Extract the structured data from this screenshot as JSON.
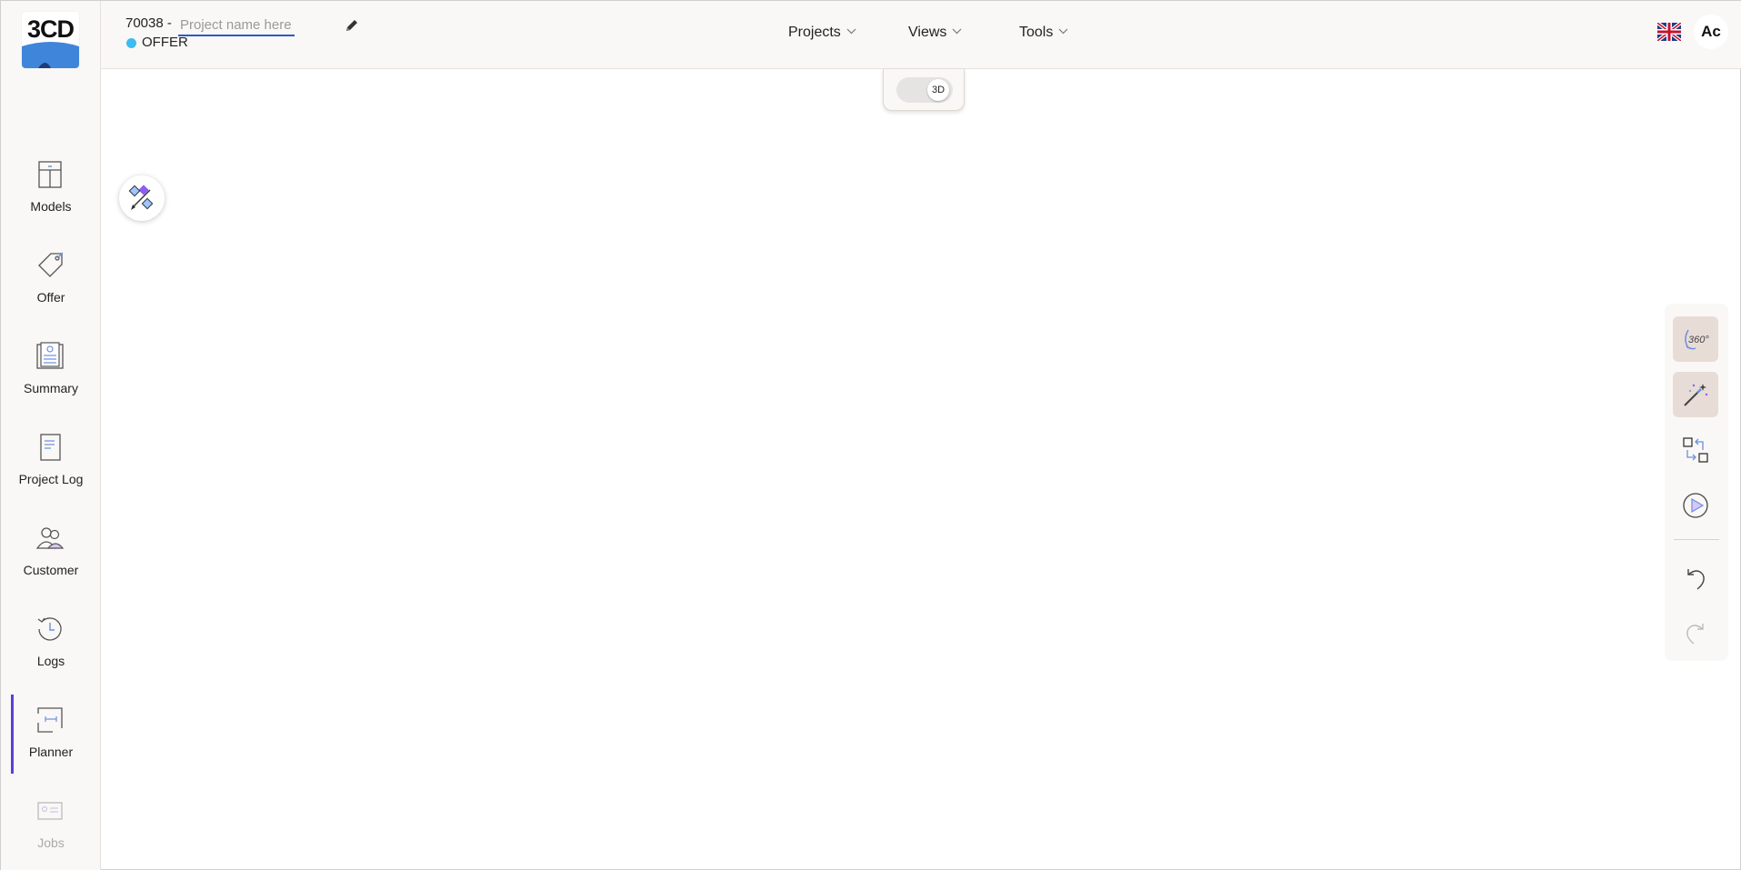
{
  "app": {
    "logo_text": "3CD",
    "accent_color": "#5b3fd6",
    "status_color": "#3cbcf0"
  },
  "sidebar": {
    "items": [
      {
        "label": "Models",
        "icon": "models-icon"
      },
      {
        "label": "Offer",
        "icon": "tag-icon"
      },
      {
        "label": "Summary",
        "icon": "summary-icon"
      },
      {
        "label": "Project Log",
        "icon": "document-icon"
      },
      {
        "label": "Customer",
        "icon": "customer-icon"
      },
      {
        "label": "Logs",
        "icon": "history-icon"
      },
      {
        "label": "Planner",
        "icon": "planner-icon",
        "active": true
      },
      {
        "label": "Jobs",
        "icon": "jobs-icon",
        "disabled": true
      }
    ]
  },
  "header": {
    "project_number": "70038 -",
    "project_name_placeholder": "Project name here",
    "project_name_value": "",
    "status": "OFFER",
    "menus": [
      "Projects",
      "Views",
      "Tools"
    ],
    "language_icon": "uk-flag-icon",
    "avatar_initials": "Ac"
  },
  "view_toggle": {
    "label": "3D",
    "on": true
  },
  "right_toolbar": {
    "buttons": [
      {
        "name": "360-view-button",
        "icon": "360-icon",
        "label": "360°",
        "highlighted": true
      },
      {
        "name": "magic-wand-button",
        "icon": "magic-wand-icon",
        "highlighted": true
      },
      {
        "name": "swap-button",
        "icon": "swap-icon",
        "highlighted": false
      },
      {
        "name": "play-button",
        "icon": "play-icon",
        "highlighted": false
      },
      {
        "name": "undo-button",
        "icon": "undo-icon",
        "enabled": true
      },
      {
        "name": "redo-button",
        "icon": "redo-icon",
        "enabled": false
      }
    ]
  }
}
